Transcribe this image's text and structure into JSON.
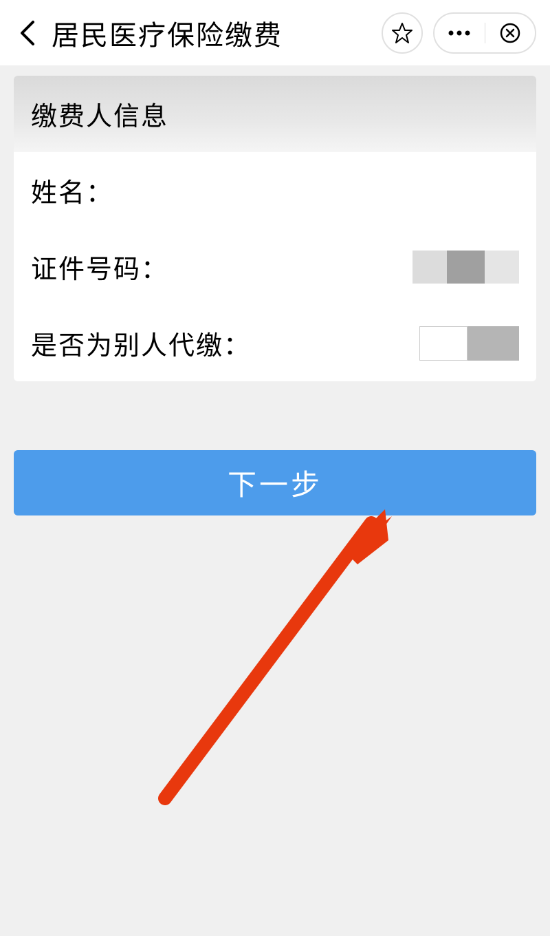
{
  "header": {
    "title": "居民医疗保险缴费"
  },
  "form": {
    "section_title": "缴费人信息",
    "name_label": "姓名：",
    "id_label": "证件号码：",
    "proxy_label": "是否为别人代缴："
  },
  "actions": {
    "next_label": "下一步"
  },
  "colors": {
    "primary": "#4d9ceb",
    "arrow": "#e8380d"
  }
}
